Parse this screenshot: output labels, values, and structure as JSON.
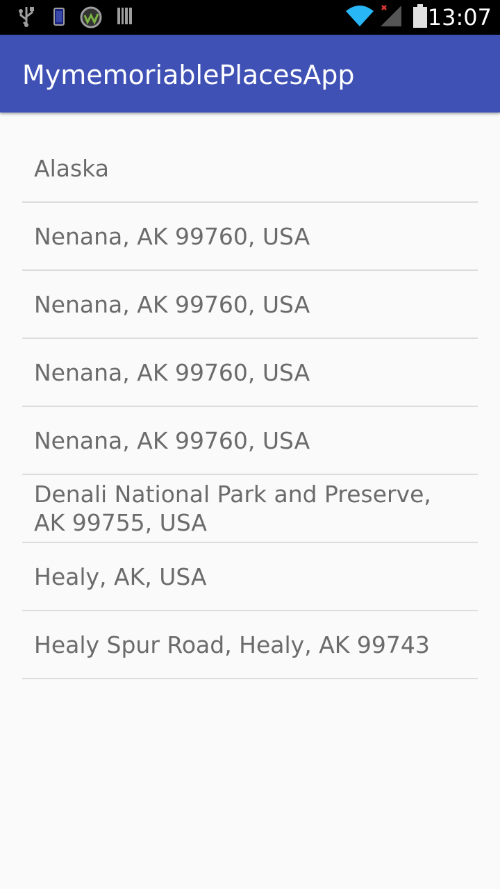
{
  "status_bar": {
    "time": "13:07",
    "left_icons": [
      "usb-icon",
      "phone-battery-icon",
      "app-notification-icon",
      "barcode-icon"
    ],
    "right_icons": [
      "wifi-icon",
      "cellular-signal-icon",
      "battery-icon"
    ]
  },
  "app_bar": {
    "title": "MymemoriablePlacesApp",
    "color": "#3f51b5"
  },
  "places": [
    {
      "label": "Alaska"
    },
    {
      "label": "Nenana, AK 99760, USA"
    },
    {
      "label": "Nenana, AK 99760, USA"
    },
    {
      "label": "Nenana, AK 99760, USA"
    },
    {
      "label": "Nenana, AK 99760, USA"
    },
    {
      "label": "Denali National Park and Preserve, AK 99755, USA"
    },
    {
      "label": "Healy, AK, USA"
    },
    {
      "label": "Healy Spur Road, Healy, AK 99743"
    }
  ]
}
